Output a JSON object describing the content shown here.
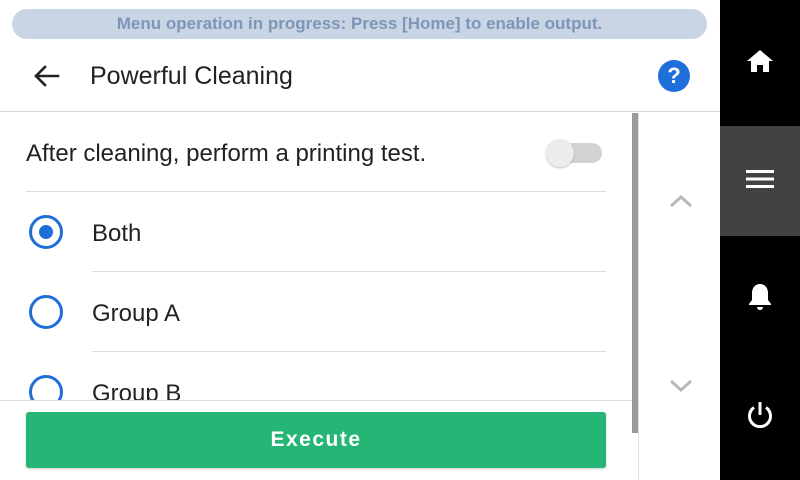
{
  "banner": {
    "text": "Menu operation in progress: Press [Home] to enable output."
  },
  "header": {
    "title": "Powerful Cleaning",
    "back_icon": "arrow-left-icon",
    "help_icon": "question-icon",
    "help_label": "?"
  },
  "toggle": {
    "label": "After cleaning, perform a printing test.",
    "state": "off"
  },
  "options": [
    {
      "label": "Both",
      "selected": true
    },
    {
      "label": "Group A",
      "selected": false
    },
    {
      "label": "Group B",
      "selected": false
    }
  ],
  "footer": {
    "execute_label": "Execute"
  },
  "nav": {
    "items": [
      {
        "icon": "home-icon",
        "active": false
      },
      {
        "icon": "menu-icon",
        "active": true
      },
      {
        "icon": "bell-icon",
        "active": false
      },
      {
        "icon": "power-icon",
        "active": false
      }
    ]
  },
  "colors": {
    "accent": "#1f6fdb",
    "execute": "#25b574",
    "banner_bg": "#c9d5e4",
    "banner_text": "#7d96b8",
    "nav_bg": "#000000",
    "nav_active": "#424242"
  }
}
